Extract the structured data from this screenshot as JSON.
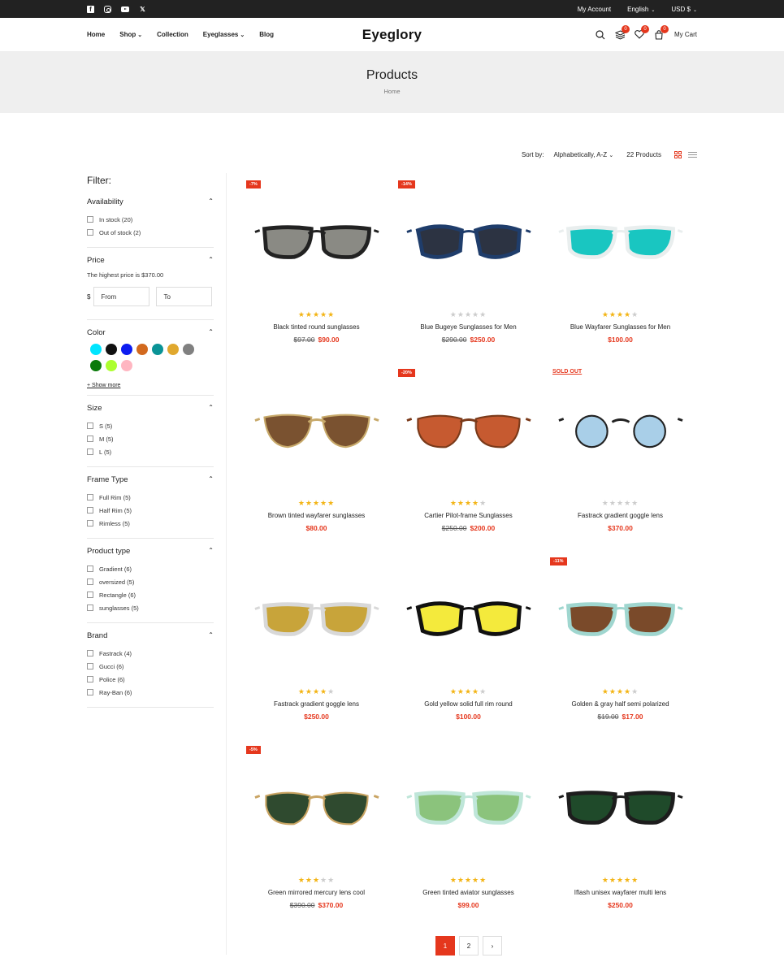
{
  "topbar": {
    "account": "My Account",
    "language": "English",
    "currency": "USD $"
  },
  "nav": {
    "items": [
      "Home",
      "Shop",
      "Collection",
      "Eyeglasses",
      "Blog"
    ]
  },
  "logo": "Eyeglory",
  "header": {
    "compare_count": "0",
    "wishlist_count": "0",
    "cart_count": "0",
    "cart_label": "My Cart"
  },
  "banner": {
    "title": "Products",
    "breadcrumb": "Home"
  },
  "toolbar": {
    "sort_label": "Sort by:",
    "sort_value": "Alphabetically, A-Z",
    "count": "22 Products"
  },
  "filters": {
    "title": "Filter:",
    "availability": {
      "title": "Availability",
      "options": [
        "In stock (20)",
        "Out of stock (2)"
      ]
    },
    "price": {
      "title": "Price",
      "note": "The highest price is $370.00",
      "currency": "$",
      "from": "From",
      "to": "To"
    },
    "color": {
      "title": "Color",
      "swatches": [
        "#00e5ff",
        "#111111",
        "#0c1cf0",
        "#d2691e",
        "#0a9396",
        "#e0a82e",
        "#808080",
        "#0a7a0a",
        "#adff2f",
        "#ffb6c1"
      ],
      "show_more": "+ Show more"
    },
    "size": {
      "title": "Size",
      "options": [
        "S (5)",
        "M (5)",
        "L (5)"
      ]
    },
    "frame_type": {
      "title": "Frame Type",
      "options": [
        "Full Rim (5)",
        "Half Rim (5)",
        "Rimless (5)"
      ]
    },
    "product_type": {
      "title": "Product type",
      "options": [
        "Gradient (6)",
        "oversized (5)",
        "Rectangle (6)",
        "sunglasses (5)"
      ]
    },
    "brand": {
      "title": "Brand",
      "options": [
        "Fastrack (4)",
        "Gucci (6)",
        "Police (6)",
        "Ray-Ban (6)"
      ]
    }
  },
  "products": [
    {
      "name": "Black tinted round sunglasses",
      "old": "$97.00",
      "price": "$90.00",
      "tag": "-7%",
      "rating": 5,
      "frame": "#222",
      "lens": "#8a8a84",
      "style": "square"
    },
    {
      "name": "Blue Bugeye Sunglasses for Men",
      "old": "$290.00",
      "price": "$250.00",
      "tag": "-14%",
      "rating": 0,
      "frame": "#1f3d6b",
      "lens": "#2c3342",
      "style": "hex"
    },
    {
      "name": "Blue Wayfarer Sunglasses for Men",
      "old": "",
      "price": "$100.00",
      "tag": "",
      "rating": 4,
      "frame": "#e9eeee",
      "lens": "#19c6c1",
      "style": "square"
    },
    {
      "name": "Brown tinted wayfarer sunglasses",
      "old": "",
      "price": "$80.00",
      "tag": "",
      "rating": 5,
      "frame": "#c7a96a",
      "lens": "#7a5230",
      "style": "cat"
    },
    {
      "name": "Cartier Pilot-frame Sunglasses",
      "old": "$250.00",
      "price": "$200.00",
      "tag": "-20%",
      "rating": 4,
      "frame": "#7a3a1a",
      "lens": "#c65a30",
      "style": "aviator"
    },
    {
      "name": "Fastrack gradient goggle lens",
      "old": "",
      "price": "$370.00",
      "tag": "",
      "sold": "SOLD OUT",
      "rating": 0,
      "frame": "#222",
      "lens": "#a9cfe8",
      "style": "round"
    },
    {
      "name": "Fastrack gradient goggle lens",
      "old": "",
      "price": "$250.00",
      "tag": "",
      "rating": 4,
      "frame": "#d8d8d8",
      "lens": "#c8a43a",
      "style": "square"
    },
    {
      "name": "Gold yellow solid full rim round",
      "old": "",
      "price": "$100.00",
      "tag": "",
      "rating": 4,
      "frame": "#111",
      "lens": "#f4ea3c",
      "style": "hex"
    },
    {
      "name": "Golden & gray half semi polarized",
      "old": "$19.00",
      "price": "$17.00",
      "tag": "-11%",
      "rating": 4,
      "frame": "#9fd6cf",
      "lens": "#7a4a2a",
      "style": "square"
    },
    {
      "name": "Green mirrored mercury lens cool",
      "old": "$390.00",
      "price": "$370.00",
      "tag": "-5%",
      "rating": 3,
      "frame": "#c9a463",
      "lens": "#2f4a2f",
      "style": "aviator"
    },
    {
      "name": "Green tinted aviator sunglasses",
      "old": "",
      "price": "$99.00",
      "tag": "",
      "rating": 5,
      "frame": "#bfe6d9",
      "lens": "#8bc37c",
      "style": "square"
    },
    {
      "name": "Iflash unisex wayfarer multi lens",
      "old": "",
      "price": "$250.00",
      "tag": "",
      "rating": 5,
      "frame": "#1d1d1d",
      "lens": "#1f4a2a",
      "style": "square"
    }
  ],
  "pagination": {
    "pages": [
      "1",
      "2"
    ],
    "next": "›"
  }
}
